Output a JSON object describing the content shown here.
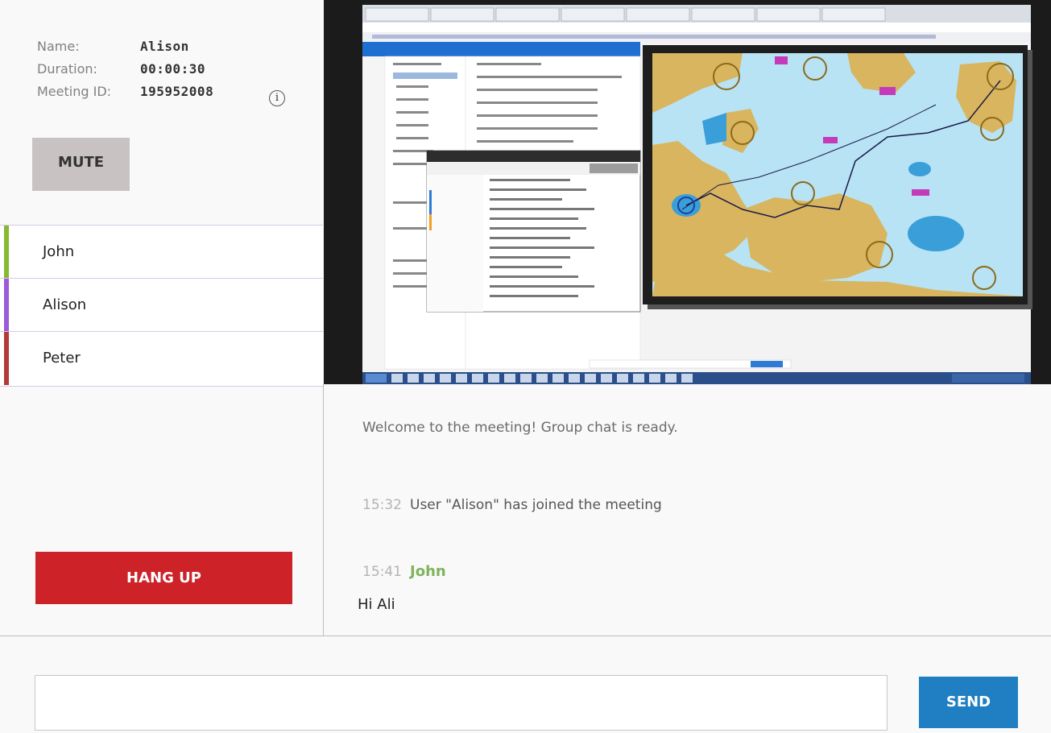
{
  "info": {
    "name_label": "Name:",
    "name_value": "Alison",
    "duration_label": "Duration:",
    "duration_value": "00:00:30",
    "meeting_label": "Meeting ID:",
    "meeting_value": "195952008",
    "info_icon": "i"
  },
  "controls": {
    "mute_label": "MUTE",
    "hangup_label": "HANG UP",
    "send_label": "SEND"
  },
  "participants": [
    {
      "name": "John",
      "color": "#86b932"
    },
    {
      "name": "Alison",
      "color": "#9a5bd8"
    },
    {
      "name": "Peter",
      "color": "#b13a3a"
    }
  ],
  "chat": {
    "welcome": "Welcome to the meeting! Group chat is ready.",
    "system_time": "15:32",
    "system_text": "User \"Alison\" has joined the meeting",
    "msg_time": "15:41",
    "msg_sender": "John",
    "msg_text": "Hi Ali"
  },
  "colors": {
    "mute_bg": "#c9c2c2",
    "hangup_bg": "#cc2228",
    "send_bg": "#1f7fc2",
    "sender_green": "#7fb35c"
  }
}
